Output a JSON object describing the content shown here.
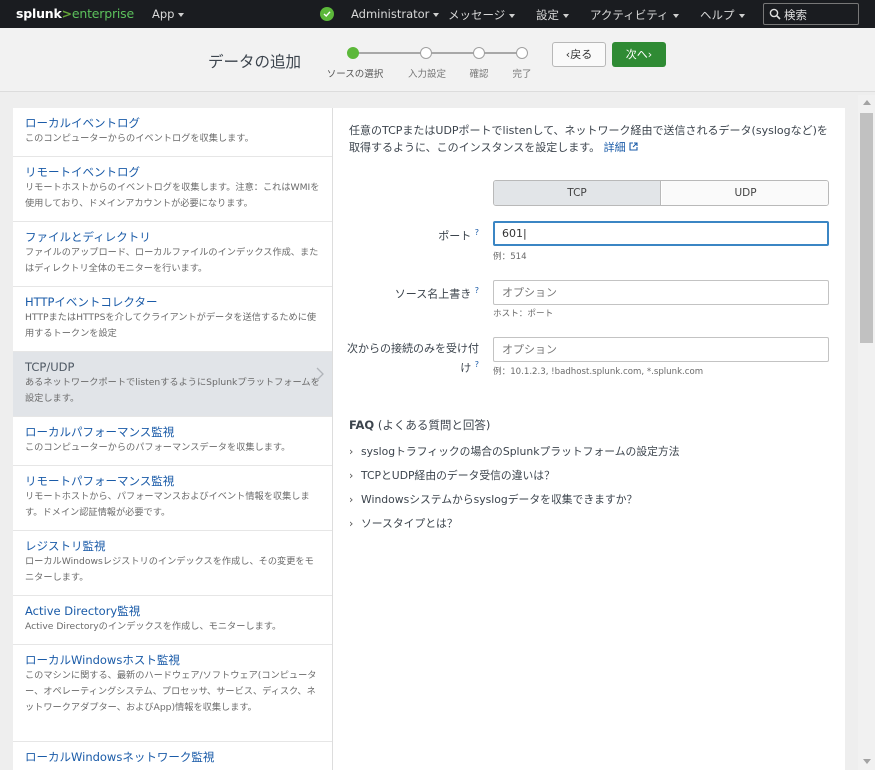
{
  "topbar": {
    "logo_main": "splunk",
    "logo_arrow": ">",
    "logo_sub": "enterprise",
    "app_menu": "App",
    "admin_menu": "Administrator",
    "messages_menu": "メッセージ",
    "settings_menu": "設定",
    "activity_menu": "アクティビティ",
    "help_menu": "ヘルプ",
    "search_placeholder": "検索"
  },
  "wizard": {
    "title": "データの追加",
    "steps": [
      {
        "label": "ソースの選択",
        "state": "active"
      },
      {
        "label": "入力設定",
        "state": "pending"
      },
      {
        "label": "確認",
        "state": "pending"
      },
      {
        "label": "完了",
        "state": "pending"
      }
    ],
    "back_label": "戻る",
    "next_label": "次へ"
  },
  "sources": [
    {
      "name": "ローカルイベントログ",
      "desc": "このコンピューターからのイベントログを収集します。"
    },
    {
      "name": "リモートイベントログ",
      "desc": "リモートホストからのイベントログを収集します。注意：これはWMIを使用しており、ドメインアカウントが必要になります。"
    },
    {
      "name": "ファイルとディレクトリ",
      "desc": "ファイルのアップロード、ローカルファイルのインデックス作成、またはディレクトリ全体のモニターを行います。"
    },
    {
      "name": "HTTPイベントコレクター",
      "desc": "HTTPまたはHTTPSを介してクライアントがデータを送信するために使用するトークンを設定"
    },
    {
      "name": "TCP/UDP",
      "desc": "あるネットワークポートでlistenするようにSplunkプラットフォームを設定します。"
    },
    {
      "name": "ローカルパフォーマンス監視",
      "desc": "このコンピューターからのパフォーマンスデータを収集します。"
    },
    {
      "name": "リモートパフォーマンス監視",
      "desc": "リモートホストから、パフォーマンスおよびイベント情報を収集します。ドメイン認証情報が必要です。"
    },
    {
      "name": "レジストリ監視",
      "desc": "ローカルWindowsレジストリのインデックスを作成し、その変更をモニターします。"
    },
    {
      "name": "Active Directory監視",
      "desc": "Active Directoryのインデックスを作成し、モニターします。"
    },
    {
      "name": "ローカルWindowsホスト監視",
      "desc": "このマシンに関する、最新のハードウェア/ソフトウェア(コンピューター、オペレーティングシステム、プロセッサ、サービス、ディスク、ネットワークアダプター、およびApp)情報を収集します。"
    },
    {
      "name": "ローカルWindowsネットワーク監視",
      "desc": ""
    }
  ],
  "panel": {
    "intro": "任意のTCPまたはUDPポートでlistenして、ネットワーク経由で送信されるデータ(syslogなど)を取得するように、このインスタンスを設定します。",
    "intro_link": "詳細",
    "protocol_tcp": "TCP",
    "protocol_udp": "UDP",
    "selected_protocol": "TCP",
    "port_label": "ポート",
    "port_value": "601",
    "port_hint": "例：514",
    "source_label": "ソース名上書き",
    "source_placeholder": "オプション",
    "source_hint": "ホスト：ポート",
    "accept_label_1": "次からの接続のみを受け付",
    "accept_label_2": "け",
    "accept_placeholder": "オプション",
    "accept_hint": "例：10.1.2.3, !badhost.splunk.com, *.splunk.com",
    "help_mark": "?"
  },
  "faq": {
    "title_bold": "FAQ",
    "title_rest": " (よくある質問と回答)",
    "items": [
      "syslogトラフィックの場合のSplunkプラットフォームの設定方法",
      "TCPとUDP経由のデータ受信の違いは？",
      "Windowsシステムからsyslogデータを収集できますか？",
      "ソースタイプとは？"
    ]
  },
  "colors": {
    "accent_green": "#5cb83a",
    "next_button": "#2f8b34",
    "link_blue": "#1a5ba8",
    "topbar_bg": "#1a1c20"
  }
}
